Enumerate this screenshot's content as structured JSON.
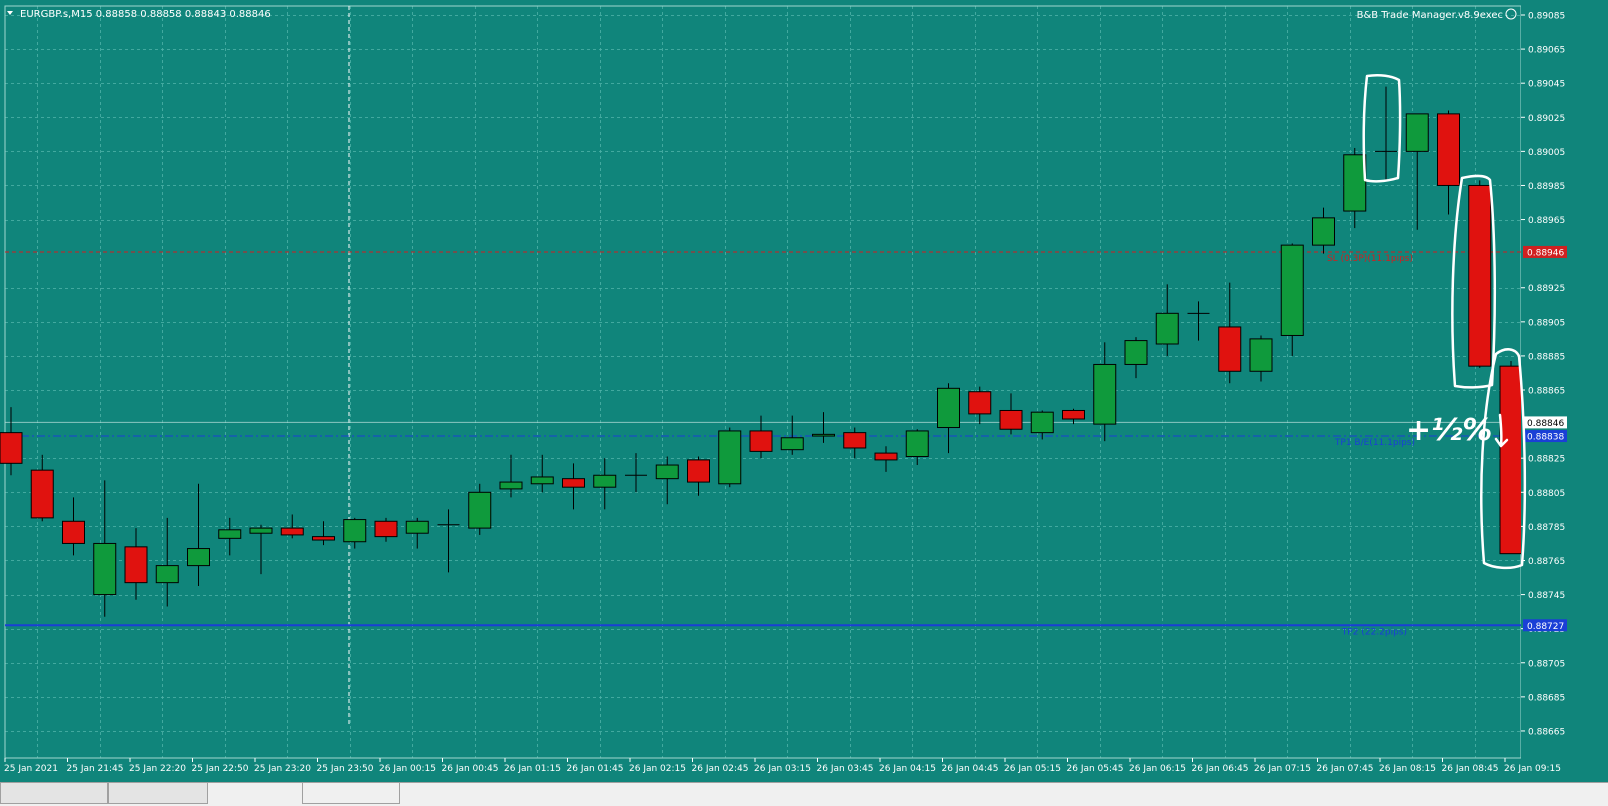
{
  "header": {
    "symbol_info": "EURGBP.s,M15  0.88858 0.88858 0.88843 0.88846",
    "expert_label": "B&B Trade Manager.v8.9exec"
  },
  "annotations": {
    "handwritten_note": "+½%"
  },
  "colors": {
    "background": "#10857b",
    "bull_candle": "#0f9a3c",
    "bear_candle": "#e0120f",
    "grid": "#4fb2a8",
    "sl_line": "#d02020",
    "tp_line": "#1a3fd6",
    "annotation": "#ffffff"
  },
  "chart_data": {
    "type": "candlestick",
    "symbol": "EURGBP.s",
    "timeframe": "M15",
    "ylim": [
      0.88655,
      0.89085
    ],
    "y_ticks": [
      0.89085,
      0.89065,
      0.89045,
      0.89025,
      0.89005,
      0.88985,
      0.88965,
      0.88925,
      0.88905,
      0.88885,
      0.88865,
      0.88825,
      0.88805,
      0.88785,
      0.88765,
      0.88745,
      0.88725,
      0.88705,
      0.88685,
      0.88665
    ],
    "x_tick_labels": [
      "25 Jan 2021",
      "25 Jan 21:45",
      "25 Jan 22:20",
      "25 Jan 22:50",
      "25 Jan 23:20",
      "25 Jan 23:50",
      "26 Jan 00:15",
      "26 Jan 00:45",
      "26 Jan 01:15",
      "26 Jan 01:45",
      "26 Jan 02:15",
      "26 Jan 02:45",
      "26 Jan 03:15",
      "26 Jan 03:45",
      "26 Jan 04:15",
      "26 Jan 04:45",
      "26 Jan 05:15",
      "26 Jan 05:45",
      "26 Jan 06:15",
      "26 Jan 06:45",
      "26 Jan 07:15",
      "26 Jan 07:45",
      "26 Jan 08:15",
      "26 Jan 08:45",
      "26 Jan 09:15"
    ],
    "candles": [
      {
        "o": 0.8884,
        "h": 0.88855,
        "l": 0.88815,
        "c": 0.88822
      },
      {
        "o": 0.88818,
        "h": 0.88827,
        "l": 0.88788,
        "c": 0.8879
      },
      {
        "o": 0.88788,
        "h": 0.88802,
        "l": 0.88768,
        "c": 0.88775
      },
      {
        "o": 0.88745,
        "h": 0.88812,
        "l": 0.88732,
        "c": 0.88775
      },
      {
        "o": 0.88773,
        "h": 0.88784,
        "l": 0.88742,
        "c": 0.88752
      },
      {
        "o": 0.88752,
        "h": 0.8879,
        "l": 0.88738,
        "c": 0.88762
      },
      {
        "o": 0.88762,
        "h": 0.8881,
        "l": 0.8875,
        "c": 0.88772
      },
      {
        "o": 0.88778,
        "h": 0.8879,
        "l": 0.88768,
        "c": 0.88783
      },
      {
        "o": 0.88781,
        "h": 0.88786,
        "l": 0.88757,
        "c": 0.88784
      },
      {
        "o": 0.88784,
        "h": 0.88792,
        "l": 0.88778,
        "c": 0.8878
      },
      {
        "o": 0.88779,
        "h": 0.88788,
        "l": 0.88774,
        "c": 0.88777
      },
      {
        "o": 0.88776,
        "h": 0.8879,
        "l": 0.88772,
        "c": 0.88789
      },
      {
        "o": 0.88788,
        "h": 0.8879,
        "l": 0.88776,
        "c": 0.88779
      },
      {
        "o": 0.88781,
        "h": 0.8879,
        "l": 0.88772,
        "c": 0.88788
      },
      {
        "o": 0.88786,
        "h": 0.88795,
        "l": 0.88758,
        "c": 0.88786
      },
      {
        "o": 0.88784,
        "h": 0.8881,
        "l": 0.8878,
        "c": 0.88805
      },
      {
        "o": 0.88807,
        "h": 0.88827,
        "l": 0.88802,
        "c": 0.88811
      },
      {
        "o": 0.8881,
        "h": 0.88827,
        "l": 0.88805,
        "c": 0.88814
      },
      {
        "o": 0.88813,
        "h": 0.88822,
        "l": 0.88795,
        "c": 0.88808
      },
      {
        "o": 0.88808,
        "h": 0.88825,
        "l": 0.88795,
        "c": 0.88815
      },
      {
        "o": 0.88815,
        "h": 0.88828,
        "l": 0.88805,
        "c": 0.88815
      },
      {
        "o": 0.88813,
        "h": 0.88826,
        "l": 0.88798,
        "c": 0.88821
      },
      {
        "o": 0.88824,
        "h": 0.88826,
        "l": 0.88803,
        "c": 0.88811
      },
      {
        "o": 0.8881,
        "h": 0.88843,
        "l": 0.88808,
        "c": 0.88841
      },
      {
        "o": 0.88841,
        "h": 0.8885,
        "l": 0.88825,
        "c": 0.88829
      },
      {
        "o": 0.8883,
        "h": 0.8885,
        "l": 0.88827,
        "c": 0.88837
      },
      {
        "o": 0.88838,
        "h": 0.88852,
        "l": 0.88834,
        "c": 0.88839
      },
      {
        "o": 0.8884,
        "h": 0.88843,
        "l": 0.88825,
        "c": 0.88831
      },
      {
        "o": 0.88828,
        "h": 0.88832,
        "l": 0.88817,
        "c": 0.88824
      },
      {
        "o": 0.88826,
        "h": 0.88842,
        "l": 0.88821,
        "c": 0.88841
      },
      {
        "o": 0.88843,
        "h": 0.88869,
        "l": 0.88828,
        "c": 0.88866
      },
      {
        "o": 0.88864,
        "h": 0.88867,
        "l": 0.88845,
        "c": 0.88851
      },
      {
        "o": 0.88853,
        "h": 0.88863,
        "l": 0.88839,
        "c": 0.88842
      },
      {
        "o": 0.8884,
        "h": 0.88853,
        "l": 0.88836,
        "c": 0.88852
      },
      {
        "o": 0.88853,
        "h": 0.88854,
        "l": 0.88845,
        "c": 0.88848
      },
      {
        "o": 0.88845,
        "h": 0.88893,
        "l": 0.88835,
        "c": 0.8888
      },
      {
        "o": 0.8888,
        "h": 0.88896,
        "l": 0.88872,
        "c": 0.88894
      },
      {
        "o": 0.88892,
        "h": 0.88927,
        "l": 0.88885,
        "c": 0.8891
      },
      {
        "o": 0.8891,
        "h": 0.88917,
        "l": 0.88894,
        "c": 0.8891
      },
      {
        "o": 0.88902,
        "h": 0.88928,
        "l": 0.88869,
        "c": 0.88876
      },
      {
        "o": 0.88876,
        "h": 0.88897,
        "l": 0.8887,
        "c": 0.88895
      },
      {
        "o": 0.88897,
        "h": 0.88951,
        "l": 0.88885,
        "c": 0.8895
      },
      {
        "o": 0.8895,
        "h": 0.88972,
        "l": 0.88945,
        "c": 0.88966
      },
      {
        "o": 0.8897,
        "h": 0.89007,
        "l": 0.8896,
        "c": 0.89003
      },
      {
        "o": 0.89005,
        "h": 0.89043,
        "l": 0.88988,
        "c": 0.89005
      },
      {
        "o": 0.89005,
        "h": 0.89027,
        "l": 0.88959,
        "c": 0.89027
      },
      {
        "o": 0.89027,
        "h": 0.89029,
        "l": 0.88968,
        "c": 0.88985
      },
      {
        "o": 0.88985,
        "h": 0.88988,
        "l": 0.88878,
        "c": 0.88879
      },
      {
        "o": 0.88879,
        "h": 0.88882,
        "l": 0.88769,
        "c": 0.88769
      }
    ],
    "levels": [
      {
        "name": "SL",
        "value": 0.88946,
        "label": "SL (0.3P)(11.1pips)",
        "tag": "0.88946"
      },
      {
        "name": "TP1",
        "value": 0.88838,
        "label": "TP1 B/E(11.1pips)",
        "tag": "0.88838"
      },
      {
        "name": "TP2",
        "value": 0.88727,
        "label": "TP2 (22.2pips)",
        "tag": "0.88727"
      }
    ],
    "current_price": {
      "value": 0.88846,
      "tag": "0.88846"
    },
    "grid": true
  }
}
